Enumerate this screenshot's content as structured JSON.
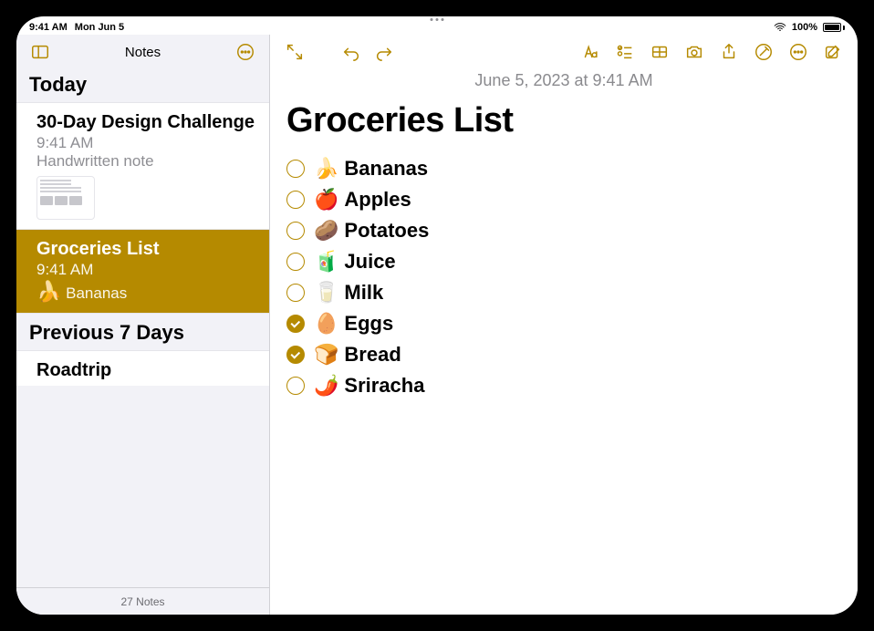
{
  "statusbar": {
    "time": "9:41 AM",
    "date": "Mon Jun 5",
    "battery_pct": "100%"
  },
  "sidebar": {
    "title": "Notes",
    "sections": [
      {
        "header": "Today"
      },
      {
        "header": "Previous 7 Days"
      }
    ],
    "items": [
      {
        "title": "30-Day Design Challenge",
        "time": "9:41 AM",
        "snippet": "Handwritten note",
        "selected": false
      },
      {
        "title": "Groceries List",
        "time": "9:41 AM",
        "snippet_emoji": "🍌",
        "snippet": "Bananas",
        "selected": true
      },
      {
        "title": "Roadtrip",
        "time": "",
        "snippet": "",
        "selected": false
      }
    ],
    "footer": "27 Notes"
  },
  "editor": {
    "date": "June 5, 2023 at 9:41 AM",
    "title": "Groceries List",
    "checklist": [
      {
        "emoji": "🍌",
        "label": "Bananas",
        "checked": false
      },
      {
        "emoji": "🍎",
        "label": "Apples",
        "checked": false
      },
      {
        "emoji": "🥔",
        "label": "Potatoes",
        "checked": false
      },
      {
        "emoji": "🧃",
        "label": "Juice",
        "checked": false
      },
      {
        "emoji": "🥛",
        "label": "Milk",
        "checked": false
      },
      {
        "emoji": "🥚",
        "label": "Eggs",
        "checked": true
      },
      {
        "emoji": "🍞",
        "label": "Bread",
        "checked": true
      },
      {
        "emoji": "🌶️",
        "label": "Sriracha",
        "checked": false
      }
    ]
  },
  "icons": {
    "sidebar_toggle": "sidebar-toggle-icon",
    "more": "more-circle-icon",
    "expand": "expand-icon",
    "undo": "undo-icon",
    "redo": "redo-icon",
    "format": "text-format-icon",
    "checklist": "checklist-icon",
    "table": "table-icon",
    "camera": "camera-icon",
    "share": "share-icon",
    "markup": "markup-icon",
    "compose": "compose-icon"
  }
}
